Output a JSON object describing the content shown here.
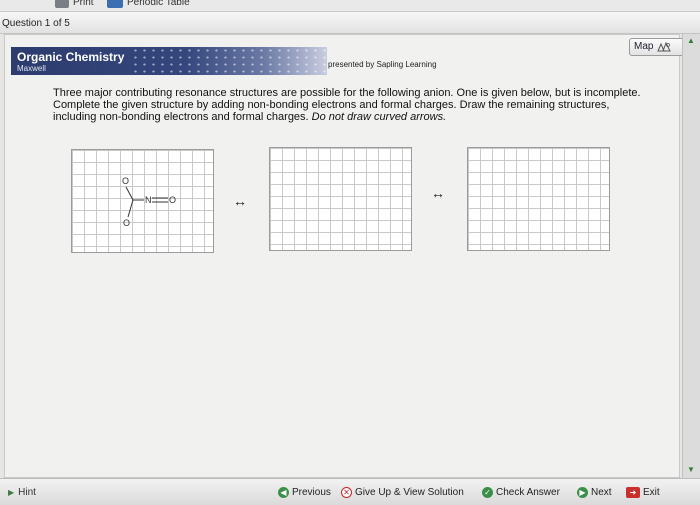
{
  "toolbar": {
    "print_label": "Print",
    "periodic_label": "Periodic Table"
  },
  "question_header": {
    "title": "Question 1 of 5"
  },
  "banner": {
    "title": "Organic Chemistry",
    "subtitle": "Maxwell",
    "presented": "presented by Sapling Learning"
  },
  "map": {
    "label": "Map"
  },
  "question": {
    "text_main": "Three major contributing resonance structures are possible for the following anion. One is given below, but is incomplete. Complete the given structure by adding non-bonding electrons and formal charges. Draw the remaining structures, including non-bonding electrons and formal charges. ",
    "text_italic": "Do not draw curved arrows."
  },
  "molecule": {
    "atom_o_top": "O",
    "atom_n": "N",
    "atom_o_right": "O",
    "atom_o_bottom": "O"
  },
  "arrows": {
    "symbol": "↔"
  },
  "bottom": {
    "hint_label": "Hint",
    "previous_label": "Previous",
    "giveup_label": "Give Up & View Solution",
    "check_label": "Check Answer",
    "next_label": "Next",
    "exit_label": "Exit"
  },
  "colors": {
    "banner_blue": "#2d3c6e",
    "nav_green": "#3b8f48",
    "giveup_red": "#cc2222",
    "exit_red": "#c9302c"
  }
}
